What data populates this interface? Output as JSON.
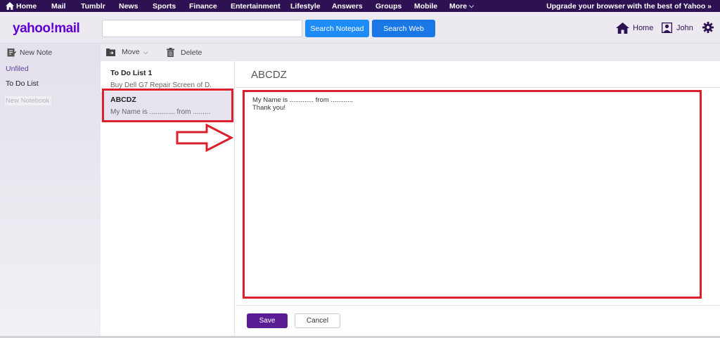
{
  "topnav": {
    "items": [
      "Home",
      "Mail",
      "Tumblr",
      "News",
      "Sports",
      "Finance",
      "Entertainment",
      "Lifestyle",
      "Answers",
      "Groups",
      "Mobile",
      "More"
    ],
    "upgrade": "Upgrade your browser with the best of Yahoo »"
  },
  "header": {
    "logo": "yahoo!mail",
    "search_value": "",
    "search_notepad": "Search Notepad",
    "search_web": "Search Web",
    "home_label": "Home",
    "user_label": "John"
  },
  "sidebar": {
    "new_note": "New Note",
    "items": [
      "Unfiled",
      "To Do List"
    ],
    "new_notebook_placeholder": "New Notebook"
  },
  "toolbar": {
    "move": "Move",
    "delete": "Delete"
  },
  "notes": [
    {
      "title": "To Do List 1",
      "snippet": "Buy Dell G7 Repair Screen of D..."
    },
    {
      "title": "ABCDZ",
      "snippet": "My Name is ............. from ..............."
    }
  ],
  "editor": {
    "title": "ABCDZ",
    "line1": "My Name is ............. from ............",
    "line2": "Thank you!",
    "save": "Save",
    "cancel": "Cancel"
  },
  "colors": {
    "topbar": "#2d1152",
    "brand": "#6001d2",
    "save_button": "#5b1d96",
    "highlight": "#d9202c"
  }
}
